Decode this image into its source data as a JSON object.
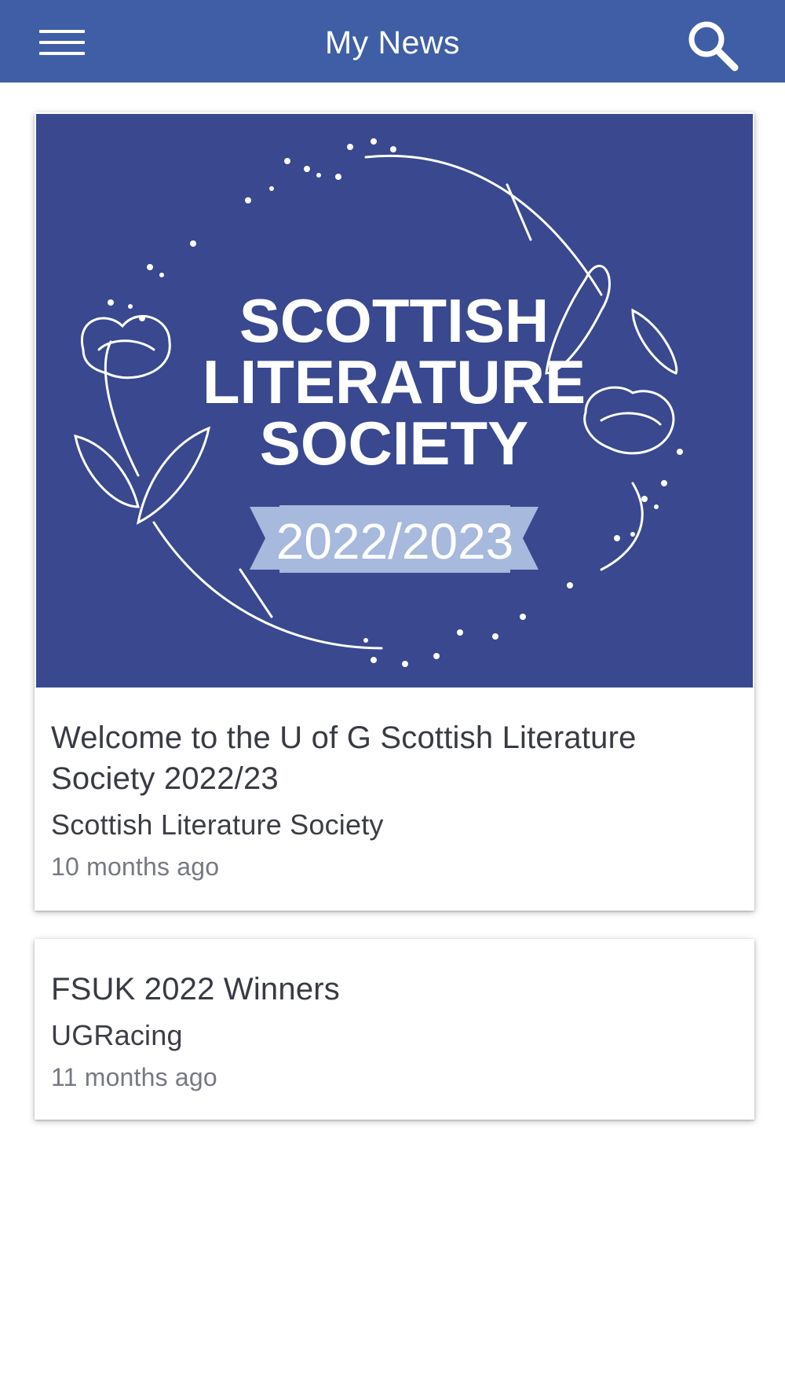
{
  "header": {
    "title": "My News",
    "menu_icon": "hamburger-menu-icon",
    "search_icon": "search-icon",
    "color": "#3f5ea6"
  },
  "news": [
    {
      "banner": {
        "line1": "SCOTTISH",
        "line2": "LITERATURE",
        "line3": "SOCIETY",
        "year": "2022/2023",
        "bg_color": "#39488f",
        "ribbon_color": "#a7b9dc"
      },
      "title": "Welcome to the U of G Scottish Literature Society 2022/23",
      "source": "Scottish Literature Society",
      "time": "10 months ago"
    },
    {
      "title": "FSUK 2022 Winners",
      "source": "UGRacing",
      "time": "11 months ago"
    }
  ]
}
